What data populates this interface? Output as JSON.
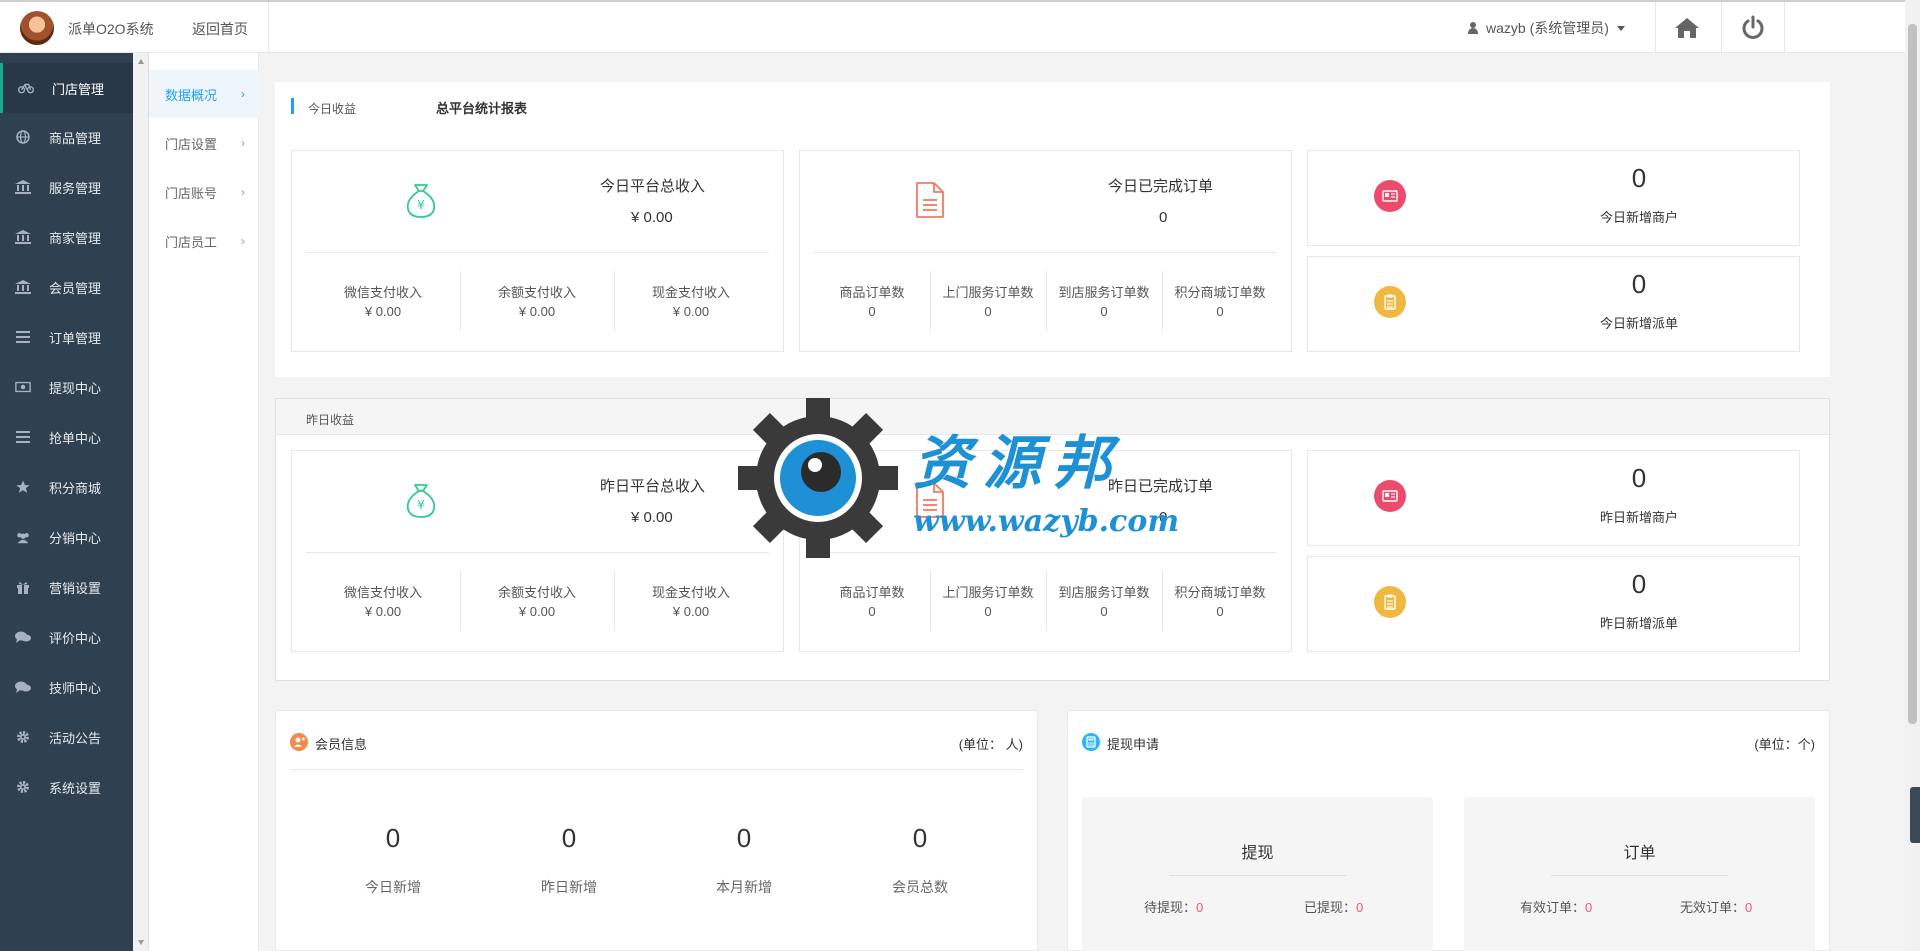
{
  "header": {
    "app_name": "派单O2O系统",
    "back_home": "返回首页",
    "user": "wazyb (系统管理员)"
  },
  "sidebar": {
    "items": [
      {
        "label": "门店管理",
        "icon": "bicycle-icon"
      },
      {
        "label": "商品管理",
        "icon": "globe-icon"
      },
      {
        "label": "服务管理",
        "icon": "bank-icon"
      },
      {
        "label": "商家管理",
        "icon": "bank-icon"
      },
      {
        "label": "会员管理",
        "icon": "bank-icon"
      },
      {
        "label": "订单管理",
        "icon": "list-icon"
      },
      {
        "label": "提现中心",
        "icon": "money-icon"
      },
      {
        "label": "抢单中心",
        "icon": "list-icon"
      },
      {
        "label": "积分商城",
        "icon": "star-icon"
      },
      {
        "label": "分销中心",
        "icon": "users-icon"
      },
      {
        "label": "营销设置",
        "icon": "gift-icon"
      },
      {
        "label": "评价中心",
        "icon": "comments-icon"
      },
      {
        "label": "技师中心",
        "icon": "comments-icon"
      },
      {
        "label": "活动公告",
        "icon": "gear-icon"
      },
      {
        "label": "系统设置",
        "icon": "gear-icon"
      }
    ]
  },
  "submenu": {
    "items": [
      {
        "label": "数据概况",
        "arrow": "›"
      },
      {
        "label": "门店设置",
        "arrow": "›"
      },
      {
        "label": "门店账号",
        "arrow": "›"
      },
      {
        "label": "门店员工",
        "arrow": "›"
      }
    ]
  },
  "today": {
    "tag": "今日收益",
    "report_title": "总平台统计报表",
    "income": {
      "title": "今日平台总收入",
      "value": "¥ 0.00",
      "cols": [
        {
          "label": "微信支付收入",
          "value": "¥ 0.00"
        },
        {
          "label": "余额支付收入",
          "value": "¥ 0.00"
        },
        {
          "label": "现金支付收入",
          "value": "¥ 0.00"
        }
      ]
    },
    "orders": {
      "title": "今日已完成订单",
      "value": "0",
      "cols": [
        {
          "label": "商品订单数",
          "value": "0"
        },
        {
          "label": "上门服务订单数",
          "value": "0"
        },
        {
          "label": "到店服务订单数",
          "value": "0"
        },
        {
          "label": "积分商城订单数",
          "value": "0"
        }
      ]
    },
    "new_merchants": {
      "num": "0",
      "label": "今日新增商户"
    },
    "new_dispatch": {
      "num": "0",
      "label": "今日新增派单"
    }
  },
  "yesterday": {
    "tag": "昨日收益",
    "income": {
      "title": "昨日平台总收入",
      "value": "¥ 0.00",
      "cols": [
        {
          "label": "微信支付收入",
          "value": "¥ 0.00"
        },
        {
          "label": "余额支付收入",
          "value": "¥ 0.00"
        },
        {
          "label": "现金支付收入",
          "value": "¥ 0.00"
        }
      ]
    },
    "orders": {
      "title": "昨日已完成订单",
      "value": "0",
      "cols": [
        {
          "label": "商品订单数",
          "value": "0"
        },
        {
          "label": "上门服务订单数",
          "value": "0"
        },
        {
          "label": "到店服务订单数",
          "value": "0"
        },
        {
          "label": "积分商城订单数",
          "value": "0"
        }
      ]
    },
    "new_merchants": {
      "num": "0",
      "label": "昨日新增商户"
    },
    "new_dispatch": {
      "num": "0",
      "label": "昨日新增派单"
    }
  },
  "members": {
    "title": "会员信息",
    "unit": "(单位：  人)",
    "stats": [
      {
        "num": "0",
        "label": "今日新增"
      },
      {
        "num": "0",
        "label": "昨日新增"
      },
      {
        "num": "0",
        "label": "本月新增"
      },
      {
        "num": "0",
        "label": "会员总数"
      }
    ]
  },
  "withdraw": {
    "title": "提现申请",
    "unit": "(单位：个)",
    "box1": {
      "title": "提现",
      "items": [
        {
          "label": "待提现：",
          "value": "0"
        },
        {
          "label": "已提现：",
          "value": "0"
        }
      ]
    },
    "box2": {
      "title": "订单",
      "items": [
        {
          "label": "有效订单：",
          "value": "0"
        },
        {
          "label": "无效订单：",
          "value": "0"
        }
      ]
    }
  },
  "watermark": {
    "text": "资源邦",
    "url": "www.wazyb.com"
  },
  "colors": {
    "sidebar_bg": "#2f4050",
    "accent_blue": "#1e9fff",
    "money_green": "#2ecc8f",
    "doc_red": "#f07a64",
    "card_pink": "#ec4b6d",
    "clip_yellow": "#f0b840",
    "value_red": "#ed5565"
  }
}
